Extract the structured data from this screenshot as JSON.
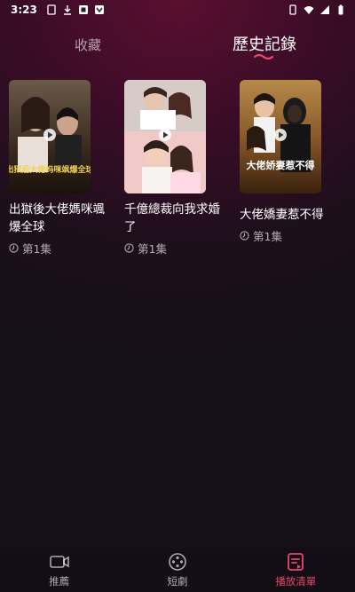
{
  "status_bar": {
    "time": "3:23",
    "icons": [
      "sim-icon",
      "download-icon",
      "notification-icon",
      "app-icon",
      "battery-icon",
      "wifi-icon",
      "signal-icon",
      "battery-level-icon"
    ]
  },
  "tabs": {
    "favorites": "收藏",
    "history": "歷史記錄",
    "active": "history",
    "accent_color": "#e8486a"
  },
  "history": [
    {
      "title": "出獄後大佬媽咪颯爆全球",
      "episode": "第1集"
    },
    {
      "title": "千億總裁向我求婚了",
      "episode": "第1集"
    },
    {
      "title": "大佬嬌妻惹不得",
      "episode": "第1集"
    }
  ],
  "posters": [
    {
      "overlay_text": "出狱后大佬妈咪飒爆全球"
    },
    {
      "overlay_text": ""
    },
    {
      "overlay_text": "大佬娇妻惹不得"
    }
  ],
  "bottom_nav": [
    {
      "label": "推薦",
      "icon": "video-camera-icon",
      "active": false
    },
    {
      "label": "短劇",
      "icon": "film-reel-icon",
      "active": false
    },
    {
      "label": "播放清單",
      "icon": "playlist-icon",
      "active": true
    }
  ]
}
